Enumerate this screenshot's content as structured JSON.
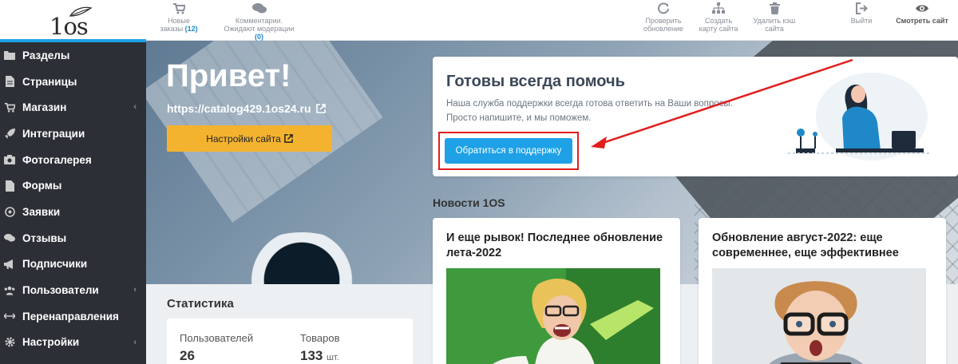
{
  "logo": {
    "text": "1os"
  },
  "topbar": {
    "orders": {
      "label": "Новые заказы",
      "count": "(12)"
    },
    "comments": {
      "label": "Комментарии. Ожидают модерации",
      "count": "(0)"
    },
    "check_update": "Проверить обновление",
    "sitemap": "Создать карту сайта",
    "clear_cache": "Удалить кэш сайта",
    "logout": "Выйти",
    "view_site": "Смотреть сайт"
  },
  "sidebar": {
    "items": [
      {
        "label": "Разделы",
        "icon": "folder-icon"
      },
      {
        "label": "Страницы",
        "icon": "page-icon"
      },
      {
        "label": "Магазин",
        "icon": "cart-icon",
        "chevron": "‹"
      },
      {
        "label": "Интеграции",
        "icon": "rocket-icon"
      },
      {
        "label": "Фотогалерея",
        "icon": "camera-icon"
      },
      {
        "label": "Формы",
        "icon": "form-icon"
      },
      {
        "label": "Заявки",
        "icon": "target-icon"
      },
      {
        "label": "Отзывы",
        "icon": "comments-icon"
      },
      {
        "label": "Подписчики",
        "icon": "megaphone-icon"
      },
      {
        "label": "Пользователи",
        "icon": "users-icon",
        "chevron": "‹"
      },
      {
        "label": "Перенаправления",
        "icon": "arrows-icon"
      },
      {
        "label": "Настройки",
        "icon": "gear-icon",
        "chevron": "‹"
      }
    ]
  },
  "hero": {
    "greeting": "Привет!",
    "site_url": "https://catalog429.1os24.ru",
    "settings_button": "Настройки сайта"
  },
  "stats": {
    "title": "Статистика",
    "users_label": "Пользователей",
    "users_value": "26",
    "goods_label": "Товаров",
    "goods_value": "133",
    "goods_unit": "шт."
  },
  "help": {
    "title": "Готовы всегда помочь",
    "text": "Наша служба поддержки всегда готова ответить на Ваши вопросы. Просто напишите, и мы поможем.",
    "button": "Обратиться в поддержку"
  },
  "news": {
    "title": "Новости 1OS",
    "cards": [
      {
        "title": "И еще рывок! Последнее обновление лета-2022"
      },
      {
        "title": "Обновление август-2022: еще современнее, еще эффективнее"
      }
    ]
  },
  "colors": {
    "accent": "#1ea1e6",
    "warning": "#f4b32f",
    "sidebar": "#2c2f36",
    "annotation": "#e11d1d",
    "count": "#1e88c8"
  }
}
